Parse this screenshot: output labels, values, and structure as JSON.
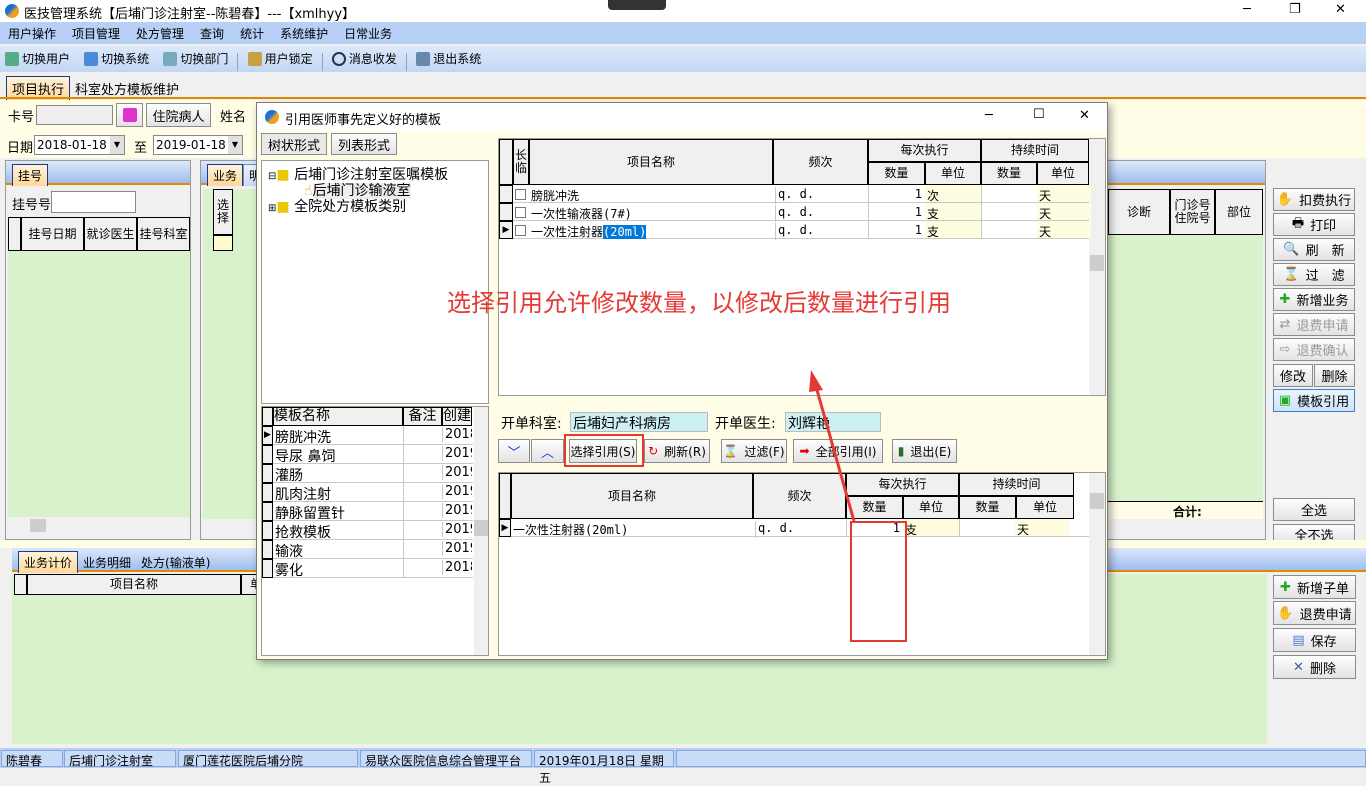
{
  "window": {
    "title": "医技管理系统【后埔门诊注射室--陈碧春】---【xmlhyy】",
    "minimize": "─",
    "maximize": "❐",
    "close": "✕"
  },
  "menu": [
    "用户操作",
    "项目管理",
    "处方管理",
    "查询",
    "统计",
    "系统维护",
    "日常业务"
  ],
  "toolbar": [
    "切换用户",
    "切换系统",
    "切换部门",
    "用户锁定",
    "消息收发",
    "退出系统"
  ],
  "main_tabs": [
    "项目执行",
    "科室处方模板维护"
  ],
  "filters": {
    "card_label": "卡号",
    "card_value": "",
    "inpatient_button": "住院病人",
    "name_label": "姓名",
    "date_label": "日期",
    "date_from": "2018-01-18",
    "to_label": "至",
    "date_to": "2019-01-18"
  },
  "registration": {
    "tab": "挂号",
    "reg_no_label": "挂号号",
    "reg_no_value": "",
    "columns": [
      "挂号日期",
      "就诊医生",
      "挂号科室"
    ]
  },
  "business": {
    "tabs": [
      "业务",
      "明"
    ],
    "columns": [
      "选择",
      "诊断",
      "门诊号住院号",
      "部位"
    ],
    "total_label": "合计:"
  },
  "right_buttons": [
    "扣费执行",
    "打印",
    "刷　新",
    "过　滤",
    "新增业务",
    "退费申请",
    "退费确认",
    "修改",
    "删除",
    "模板引用",
    "全选",
    "全不选"
  ],
  "bottom": {
    "tabs": [
      "业务计价",
      "业务明细",
      "处方(输液单)"
    ],
    "columns": [
      "项目名称",
      "单"
    ],
    "buttons": [
      "新增子单",
      "退费申请",
      "保存",
      "删除"
    ]
  },
  "dialog": {
    "title": "引用医师事先定义好的模板",
    "view_tabs": [
      "树状形式",
      "列表形式"
    ],
    "tree": [
      {
        "label": "后埔门诊注射室医嘱模板",
        "expanded": true,
        "children": [
          "后埔门诊输液室"
        ]
      },
      {
        "label": "全院处方模板类别",
        "expanded": false
      }
    ],
    "template_list": {
      "columns": [
        "模板名称",
        "备注",
        "创建"
      ],
      "rows": [
        [
          "膀胱冲洗",
          "",
          "2018"
        ],
        [
          "导尿 鼻饲",
          "",
          "2019"
        ],
        [
          "灌肠",
          "",
          "2019"
        ],
        [
          "肌肉注射",
          "",
          "2019"
        ],
        [
          "静脉留置针",
          "",
          "2019"
        ],
        [
          "抢救模板",
          "",
          "2019"
        ],
        [
          "输液",
          "",
          "2019"
        ],
        [
          "雾化",
          "",
          "2018"
        ]
      ]
    },
    "upper_grid": {
      "columns": {
        "long": "长临",
        "name": "项目名称",
        "freq": "频次",
        "per_exec": "每次执行",
        "duration": "持续时间",
        "qty": "数量",
        "unit": "单位"
      },
      "rows": [
        {
          "name": "膀胱冲洗",
          "freq": "q. d.",
          "qty": "1",
          "unit": "次",
          "dur_qty": "",
          "dur_unit": "天"
        },
        {
          "name": "一次性输液器(7#)",
          "freq": "q. d.",
          "qty": "1",
          "unit": "支",
          "dur_qty": "",
          "dur_unit": "天"
        },
        {
          "name": "一次性注射器",
          "name_selected": "(20ml)",
          "freq": "q. d.",
          "qty": "1",
          "unit": "支",
          "dur_qty": "",
          "dur_unit": "天"
        }
      ]
    },
    "annotation": "选择引用允许修改数量，以修改后数量进行引用",
    "dept_label": "开单科室:",
    "dept_value": "后埔妇产科病房",
    "doctor_label": "开单医生:",
    "doctor_value": "刘辉艳",
    "buttons": [
      "选择引用(S)",
      "刷新(R)",
      "过滤(F)",
      "全部引用(I)",
      "退出(E)"
    ],
    "lower_grid": {
      "rows": [
        {
          "name": "一次性注射器(20ml)",
          "freq": "q. d.",
          "qty": "1",
          "unit": "支",
          "dur_qty": "",
          "dur_unit": "天"
        }
      ]
    }
  },
  "statusbar": [
    "陈碧春",
    "后埔门诊注射室",
    "厦门莲花医院后埔分院",
    "易联众医院信息综合管理平台",
    "2019年01月18日 星期五"
  ],
  "colors": {
    "annotation_red": "#e53935",
    "grid_green": "#d9f2cc",
    "panel_yellow": "#fffde6",
    "selection_blue": "#0078d7"
  }
}
